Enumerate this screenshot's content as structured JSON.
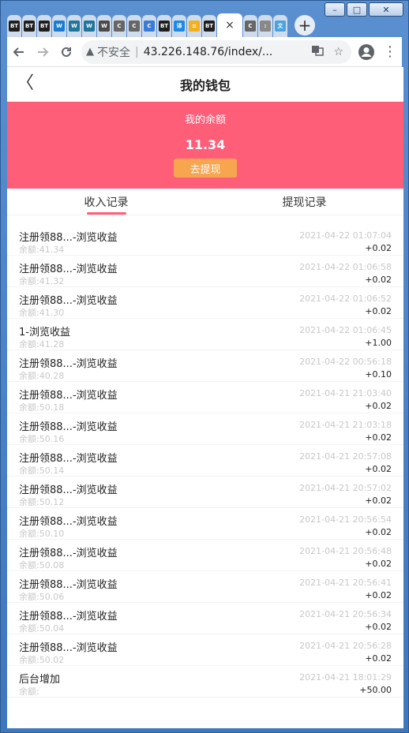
{
  "browser": {
    "window_controls": [
      "–",
      "□",
      "✕"
    ],
    "tabs": [
      {
        "icon": "BT",
        "color": "#1f1f1f"
      },
      {
        "icon": "BT",
        "color": "#1f1f1f"
      },
      {
        "icon": "BT",
        "color": "#1f1f1f"
      },
      {
        "icon": "W",
        "color": "#1b7bd1"
      },
      {
        "icon": "W",
        "color": "#21759b"
      },
      {
        "icon": "W",
        "color": "#21759b"
      },
      {
        "icon": "W",
        "color": "#4a4a4a"
      },
      {
        "icon": "C",
        "color": "#666666"
      },
      {
        "icon": "C",
        "color": "#666666"
      },
      {
        "icon": "C",
        "color": "#3a7bd5"
      },
      {
        "icon": "BT",
        "color": "#1f1f1f"
      },
      {
        "icon": "译",
        "color": "#1e88e5"
      },
      {
        "icon": "≡",
        "color": "#f2b01e"
      },
      {
        "icon": "BT",
        "color": "#1f1f1f"
      }
    ],
    "active_tab_close": "×",
    "tail_tabs": [
      {
        "icon": "C",
        "color": "#666666"
      },
      {
        "icon": ":",
        "color": "#888888"
      },
      {
        "icon": "文",
        "color": "#4aa3df"
      }
    ],
    "new_tab": "+",
    "address": {
      "security_label": "不安全",
      "separator": "|",
      "url": "43.226.148.76/index/..."
    }
  },
  "page": {
    "title": "我的钱包",
    "back": "〈",
    "balance_label": "我的余额",
    "balance_amount": "11.34",
    "withdraw_button": "去提现",
    "tabs": [
      {
        "label": "收入记录",
        "active": true
      },
      {
        "label": "提现记录",
        "active": false
      }
    ],
    "records": [
      {
        "name": "注册领88...-浏览收益",
        "time": "2021-04-22 01:07:04",
        "balance": "余额:41.34",
        "amount": "+0.02"
      },
      {
        "name": "注册领88...-浏览收益",
        "time": "2021-04-22 01:06:58",
        "balance": "余额:41.32",
        "amount": "+0.02"
      },
      {
        "name": "注册领88...-浏览收益",
        "time": "2021-04-22 01:06:52",
        "balance": "余额:41.30",
        "amount": "+0.02"
      },
      {
        "name": "1-浏览收益",
        "time": "2021-04-22 01:06:45",
        "balance": "余额:41.28",
        "amount": "+1.00"
      },
      {
        "name": "注册领88...-浏览收益",
        "time": "2021-04-22 00:56:18",
        "balance": "余额:40.28",
        "amount": "+0.10"
      },
      {
        "name": "注册领88...-浏览收益",
        "time": "2021-04-21 21:03:40",
        "balance": "余额:50.18",
        "amount": "+0.02"
      },
      {
        "name": "注册领88...-浏览收益",
        "time": "2021-04-21 21:03:18",
        "balance": "余额:50.16",
        "amount": "+0.02"
      },
      {
        "name": "注册领88...-浏览收益",
        "time": "2021-04-21 20:57:08",
        "balance": "余额:50.14",
        "amount": "+0.02"
      },
      {
        "name": "注册领88...-浏览收益",
        "time": "2021-04-21 20:57:02",
        "balance": "余额:50.12",
        "amount": "+0.02"
      },
      {
        "name": "注册领88...-浏览收益",
        "time": "2021-04-21 20:56:54",
        "balance": "余额:50.10",
        "amount": "+0.02"
      },
      {
        "name": "注册领88...-浏览收益",
        "time": "2021-04-21 20:56:48",
        "balance": "余额:50.08",
        "amount": "+0.02"
      },
      {
        "name": "注册领88...-浏览收益",
        "time": "2021-04-21 20:56:41",
        "balance": "余额:50.06",
        "amount": "+0.02"
      },
      {
        "name": "注册领88...-浏览收益",
        "time": "2021-04-21 20:56:34",
        "balance": "余额:50.04",
        "amount": "+0.02"
      },
      {
        "name": "注册领88...-浏览收益",
        "time": "2021-04-21 20:56:28",
        "balance": "余额:50.02",
        "amount": "+0.02"
      },
      {
        "name": "后台增加",
        "time": "2021-04-21 18:01:29",
        "balance": "余额:",
        "amount": "+50.00"
      }
    ]
  }
}
